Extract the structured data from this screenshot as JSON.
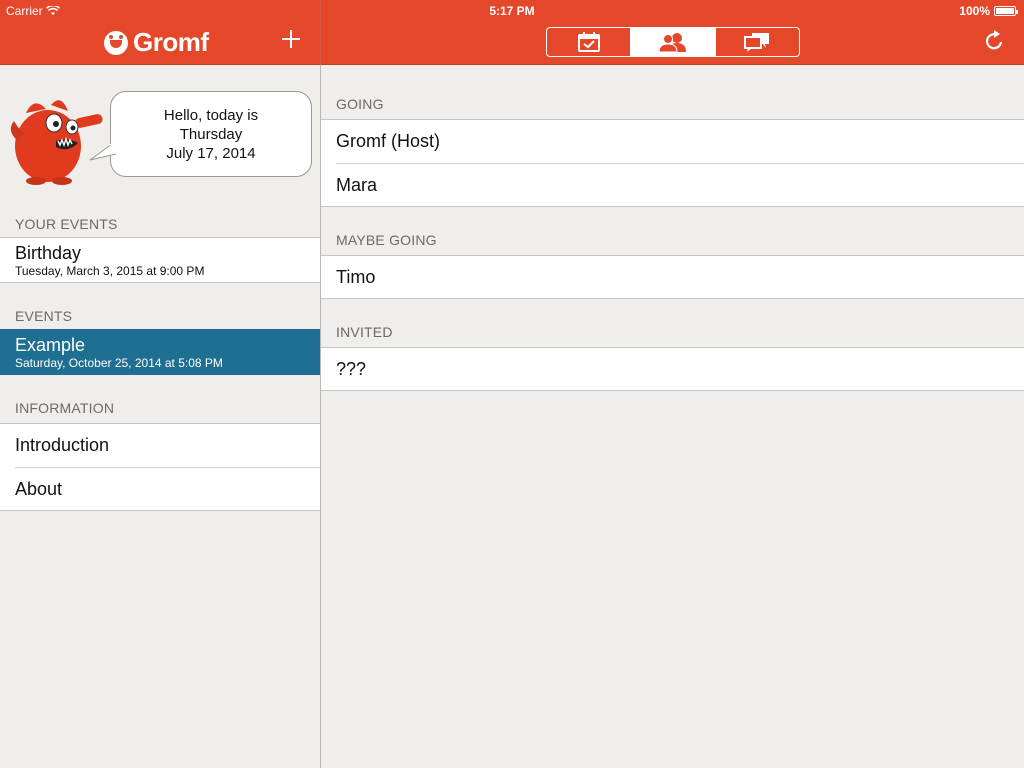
{
  "status_bar": {
    "carrier": "Carrier",
    "time": "5:17 PM",
    "battery": "100%"
  },
  "header": {
    "app_name": "Gromf",
    "tabs": [
      {
        "icon": "calendar-check-icon",
        "active": false
      },
      {
        "icon": "people-icon",
        "active": true
      },
      {
        "icon": "chat-bubbles-icon",
        "active": false
      }
    ]
  },
  "sidebar": {
    "greeting": {
      "line1": "Hello, today is",
      "line2": "Thursday",
      "line3": "July 17, 2014"
    },
    "your_events_header": "YOUR EVENTS",
    "your_events": [
      {
        "title": "Birthday",
        "subtitle": "Tuesday, March 3, 2015 at 9:00 PM"
      }
    ],
    "events_header": "EVENTS",
    "events": [
      {
        "title": "Example",
        "subtitle": "Saturday, October 25, 2014 at 5:08 PM",
        "selected": true
      }
    ],
    "information_header": "INFORMATION",
    "information": [
      {
        "title": "Introduction"
      },
      {
        "title": "About"
      }
    ]
  },
  "main": {
    "going_header": "GOING",
    "going": [
      "Gromf (Host)",
      "Mara"
    ],
    "maybe_header": "MAYBE GOING",
    "maybe": [
      "Timo"
    ],
    "invited_header": "INVITED",
    "invited": [
      "???"
    ]
  },
  "colors": {
    "accent": "#e5472a",
    "selected_row": "#1f6f92",
    "background": "#efeeeb"
  }
}
